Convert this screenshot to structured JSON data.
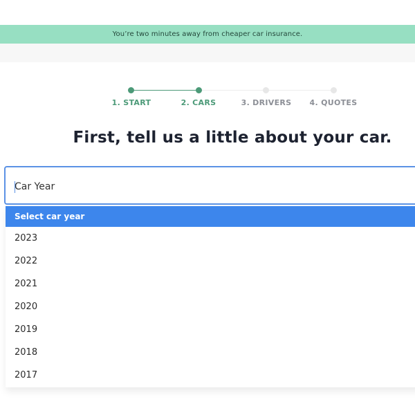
{
  "banner": {
    "text": "You’re two minutes away from cheaper car insurance."
  },
  "stepper": {
    "steps": [
      {
        "label": "1. START",
        "state": "complete"
      },
      {
        "label": "2. CARS",
        "state": "current"
      },
      {
        "label": "3. DRIVERS",
        "state": "upcoming"
      },
      {
        "label": "4. QUOTES",
        "state": "upcoming"
      }
    ]
  },
  "heading": "First, tell us a little about your car.",
  "car_year_select": {
    "placeholder": "Car Year",
    "options": [
      "Select car year",
      "2023",
      "2022",
      "2021",
      "2020",
      "2019",
      "2018",
      "2017"
    ],
    "highlighted": "Select car year"
  },
  "colors": {
    "banner_bg": "#97dfc2",
    "step_active": "#4c9a78",
    "step_inactive": "#e7e7e7",
    "focus_border": "#5b92e5",
    "highlight_bg": "#3d86ec"
  }
}
